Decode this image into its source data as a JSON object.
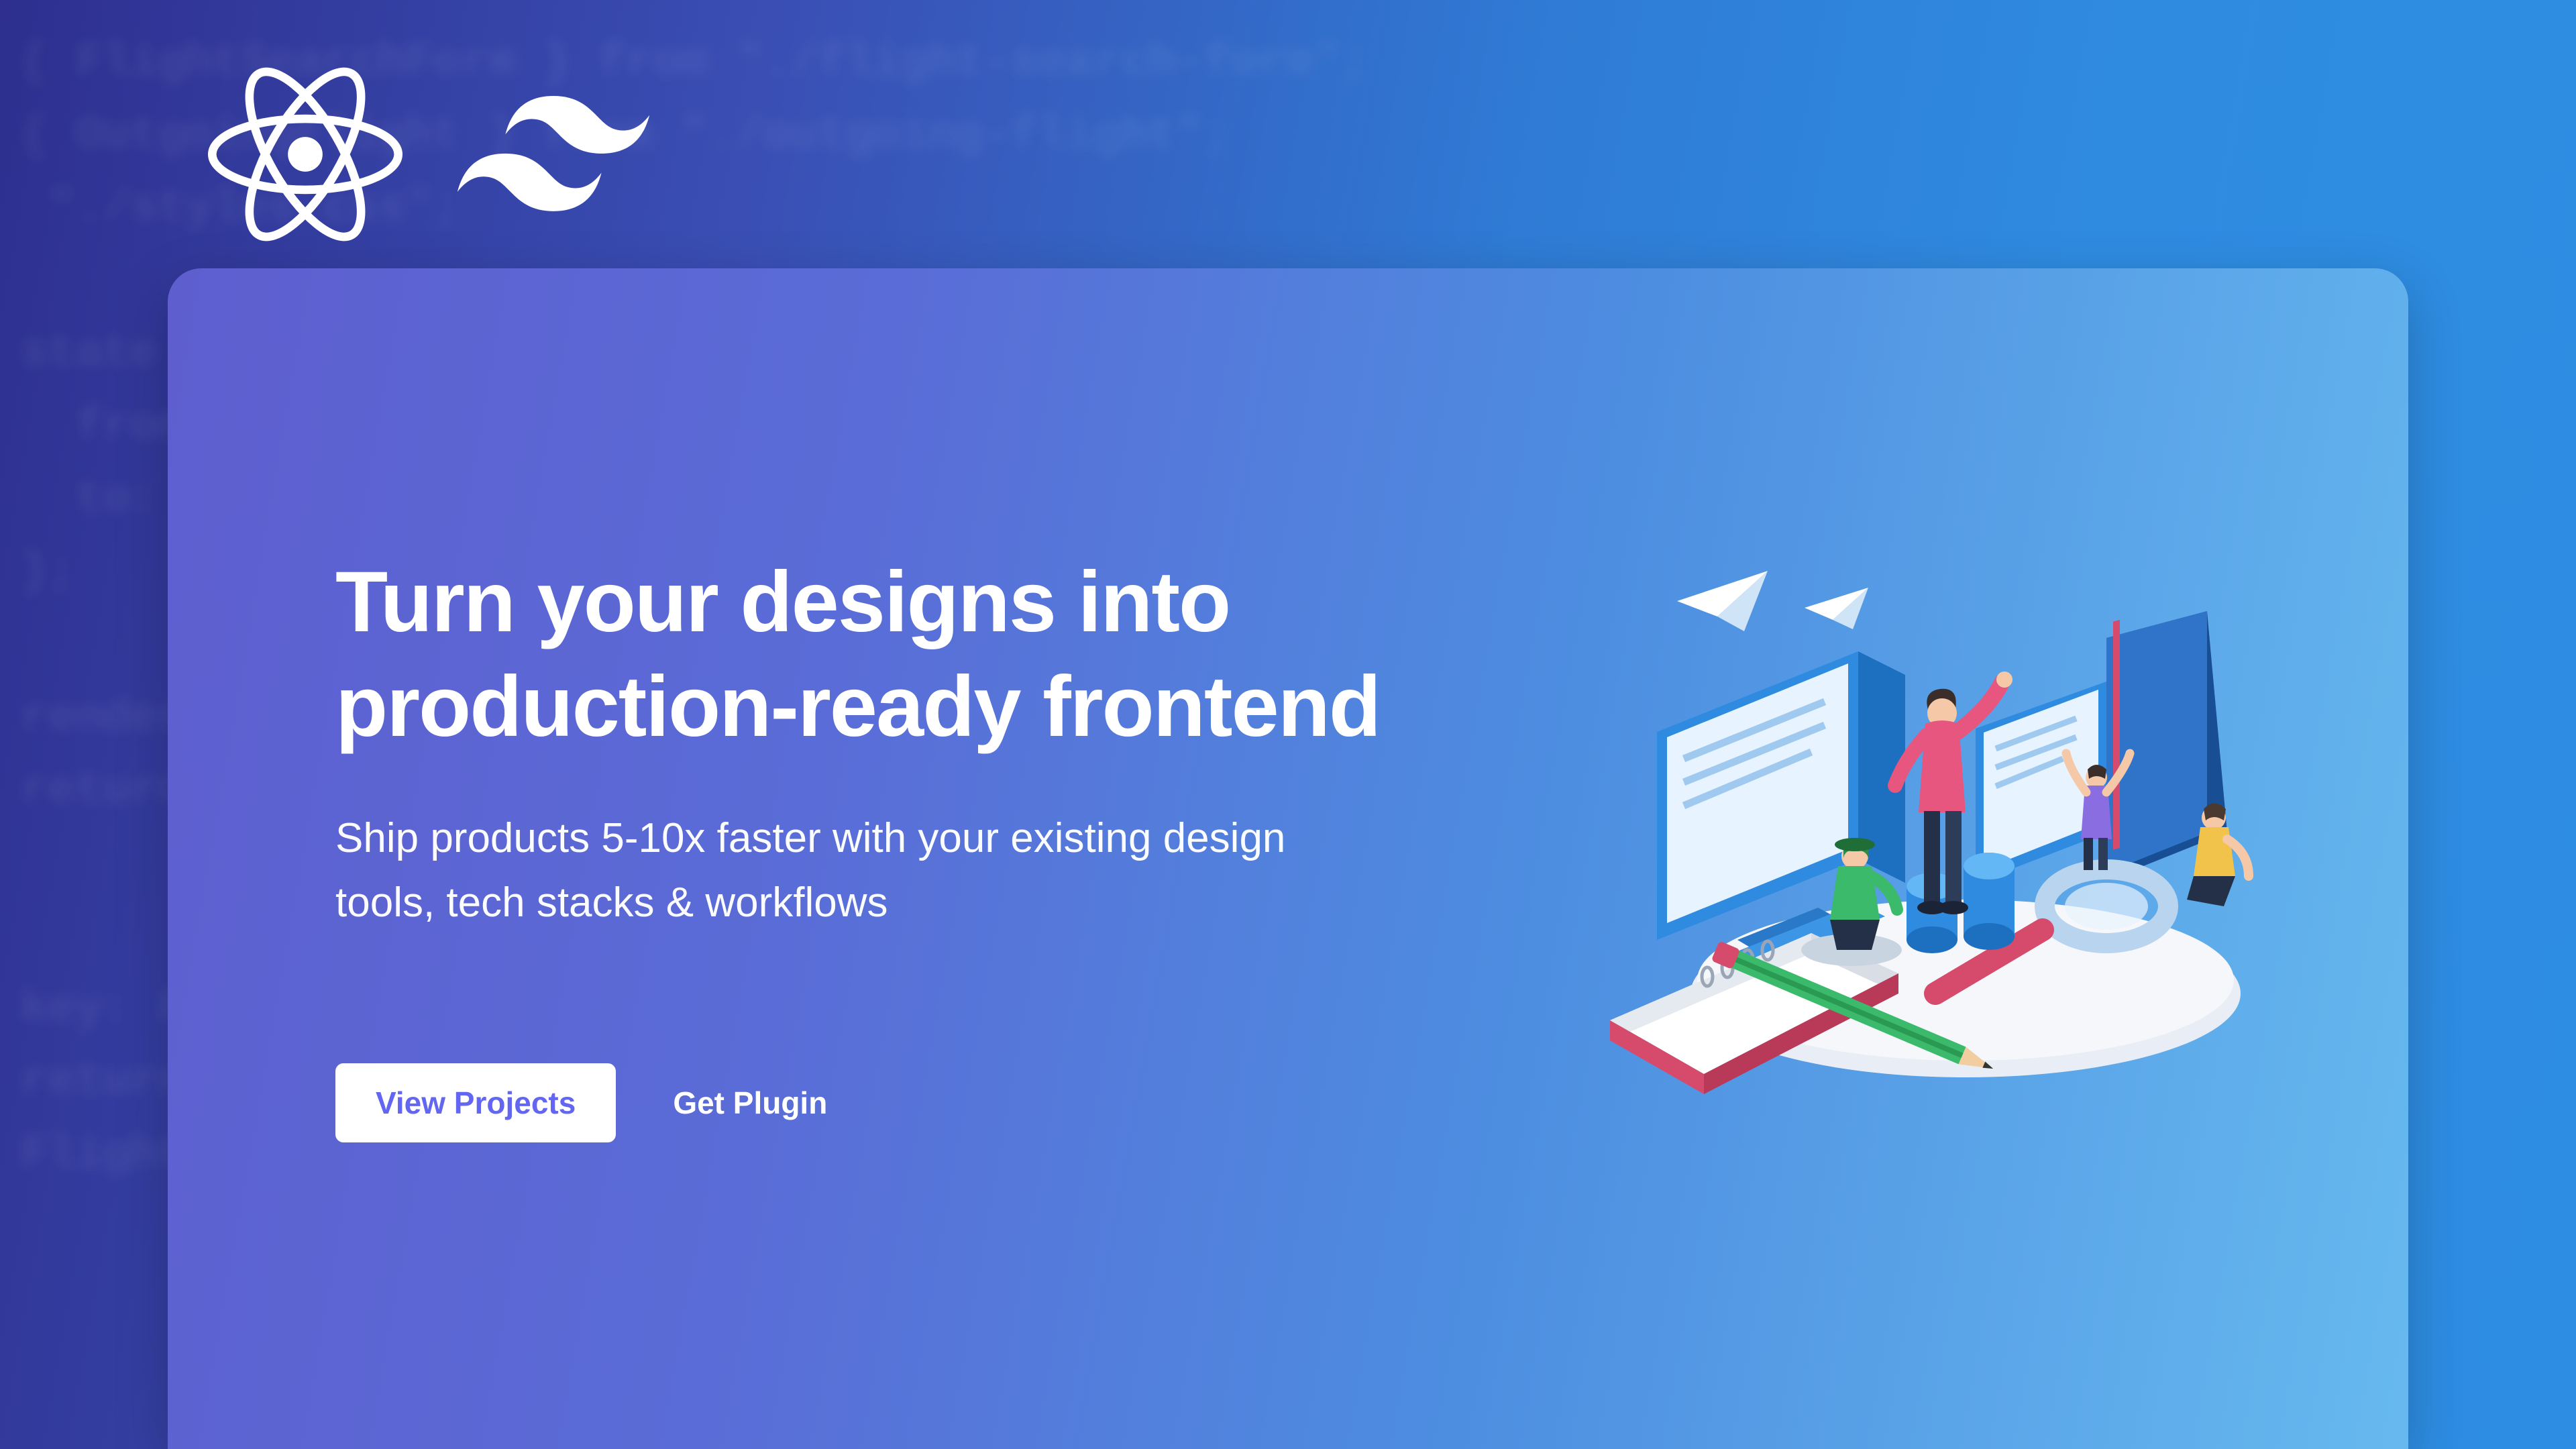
{
  "bg_code": "{ FlightSearchForm } from \"./flight-search-form\";\n{ OutgoingFlight } from \"./outgoing-flight\";\n \"./styles.css\";\n \nstate = {\n  from: \"SFO\",\n  to:   \"NYC\",   dep: null\n};\n\nrender()\nreturn ( <FlightSearchForm /> );\n \n \nkey: FlightSearch\nreturn ( <App /> );\nFlightSearchForm",
  "hero": {
    "title": "Turn your designs into production-ready frontend",
    "subtitle": "Ship products 5-10x faster with your existing design tools, tech stacks & workflows"
  },
  "buttons": {
    "primary": "View Projects",
    "secondary": "Get Plugin"
  },
  "logos": {
    "react": "react-icon",
    "tailwind": "tailwind-icon"
  },
  "colors": {
    "primary_btn_text": "#6366f1",
    "white": "#ffffff"
  }
}
